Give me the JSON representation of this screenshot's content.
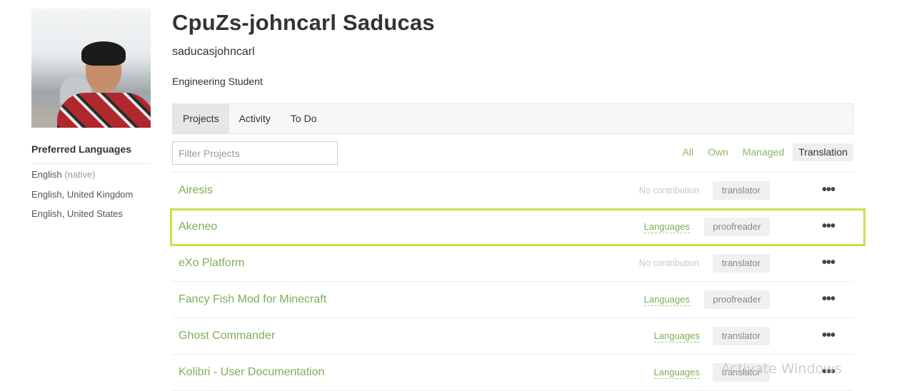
{
  "profile": {
    "full_name": "CpuZs-johncarl Saducas",
    "username": "saducasjohncarl",
    "bio": "Engineering Student"
  },
  "languages": {
    "title": "Preferred Languages",
    "items": [
      {
        "name": "English",
        "note": "(native)"
      },
      {
        "name": "English, United Kingdom",
        "note": ""
      },
      {
        "name": "English, United States",
        "note": ""
      }
    ]
  },
  "tabs": [
    {
      "label": "Projects",
      "active": true
    },
    {
      "label": "Activity",
      "active": false
    },
    {
      "label": "To Do",
      "active": false
    }
  ],
  "filter": {
    "placeholder": "Filter Projects"
  },
  "filter_buttons": [
    {
      "label": "All",
      "active": false
    },
    {
      "label": "Own",
      "active": false
    },
    {
      "label": "Managed",
      "active": false
    },
    {
      "label": "Translation",
      "active": true
    }
  ],
  "projects": [
    {
      "name": "Airesis",
      "contribution": "No contribution",
      "role": "translator"
    },
    {
      "name": "Akeneo",
      "contribution": "Languages",
      "role": "proofreader"
    },
    {
      "name": "eXo Platform",
      "contribution": "No contribution",
      "role": "translator"
    },
    {
      "name": "Fancy Fish Mod for Minecraft",
      "contribution": "Languages",
      "role": "proofreader"
    },
    {
      "name": "Ghost Commander",
      "contribution": "Languages",
      "role": "translator"
    },
    {
      "name": "Kolibri - User Documentation",
      "contribution": "Languages",
      "role": "translator"
    }
  ],
  "more_icon": "•••",
  "watermark": "Activate Windows",
  "colors": {
    "link": "#7fad55",
    "highlight": "#c7e24b"
  }
}
